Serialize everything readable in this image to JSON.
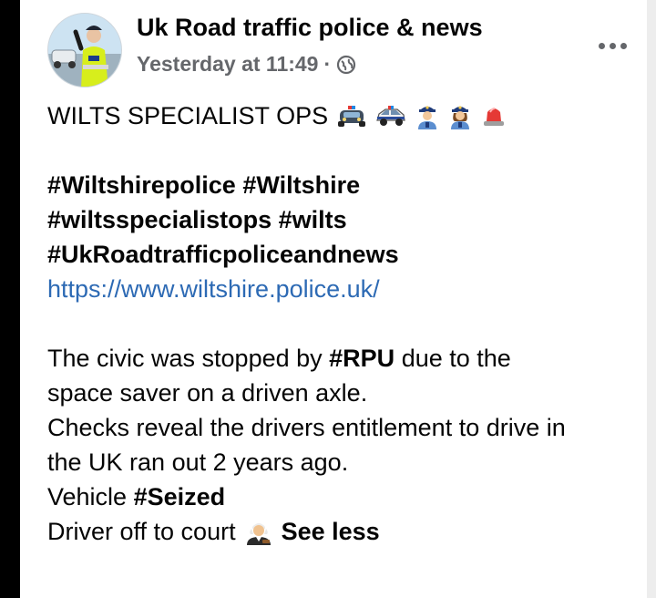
{
  "post": {
    "page_name": "Uk Road traffic police & news",
    "timestamp": "Yesterday at 11:49",
    "separator": "·",
    "audience_icon": "globe-icon",
    "more_icon": "more-options-icon",
    "heading": "WILTS SPECIALIST OPS",
    "heading_emojis": [
      "police-car-icon",
      "oncoming-police-car-icon",
      "police-officer-icon",
      "woman-police-officer-icon",
      "rotating-light-icon"
    ],
    "hashtags_line1": "#Wiltshirepolice #Wiltshire",
    "hashtags_line2": "#wiltsspecialistops #wilts",
    "hashtags_line3": "#UkRoadtrafficpoliceandnews",
    "link": "https://www.wiltshire.police.uk/",
    "body": {
      "l1_pre": "The civic was stopped by ",
      "l1_tag": "#RPU",
      "l1_post": " due to the",
      "l2": "space saver on a driven axle.",
      "l3": "Checks reveal the drivers entitlement to drive in",
      "l4": "the UK ran out 2 years ago.",
      "l5_pre": "Vehicle ",
      "l5_tag": "#Seized",
      "l6": "Driver off to court",
      "l6_emoji": "judge-icon",
      "see_less": "See less"
    }
  },
  "colors": {
    "text": "#050505",
    "meta": "#65676b",
    "link": "#2d6ab4"
  }
}
